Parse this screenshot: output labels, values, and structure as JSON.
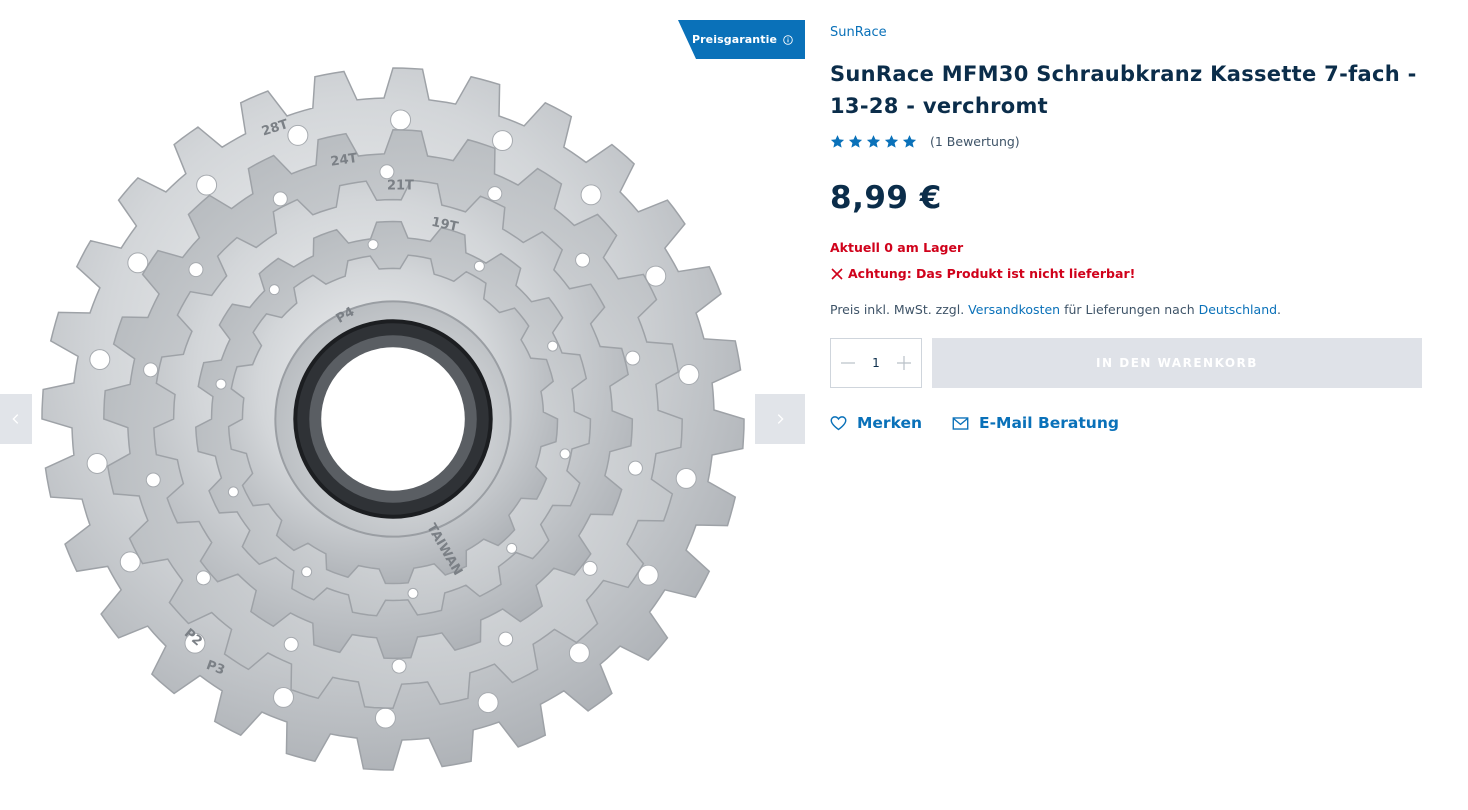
{
  "gallery": {
    "badge_label": "Preisgarantie",
    "image_alt": "SunRace MFM30 Schraubkranz Kassette 7-fach - 13-28 - verchromt",
    "engravings": [
      "28T",
      "24T",
      "21T",
      "19T",
      "P4",
      "TAIWAN",
      "P3",
      "P2"
    ]
  },
  "product": {
    "brand": "SunRace",
    "title": "SunRace MFM30 Schraubkranz Kassette 7-fach - 13-28 - verchromt",
    "rating_stars": 5,
    "rating_count_text": "(1 Bewertung)",
    "price": "8,99 €",
    "stock_text": "Aktuell 0 am Lager",
    "warning_text": "Achtung: Das Produkt ist nicht lieferbar!",
    "tax": {
      "prefix": "Preis inkl. MwSt. zzgl.",
      "shipping_link": "Versandkosten",
      "middle": "für Lieferungen nach",
      "country_link": "Deutschland",
      "suffix": "."
    },
    "quantity": "1",
    "cart_button": "IN DEN WARENKORB",
    "wishlist_label": "Merken",
    "email_label": "E-Mail Beratung"
  },
  "colors": {
    "accent": "#0a71b9",
    "title": "#0b2d4a",
    "error": "#d0021b",
    "disabled_button": "#dfe2e8"
  },
  "icons": [
    "chevron-left-icon",
    "chevron-right-icon",
    "info-icon",
    "star-icon",
    "close-x-icon",
    "minus-icon",
    "plus-icon",
    "heart-icon",
    "mail-icon"
  ]
}
